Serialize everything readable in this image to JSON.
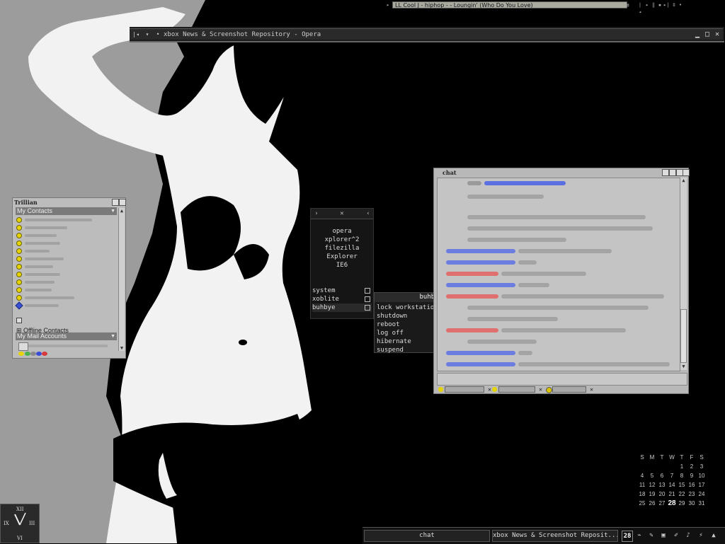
{
  "media_player": {
    "track_title": "LL Cool J - hiphop - - Loungin' (Who Do You Love)",
    "icons": [
      "prev-icon",
      "play-icon",
      "pause-icon",
      "stop-icon",
      "next-icon",
      "menu-icon"
    ]
  },
  "browser_window": {
    "title": "xbox News & Screenshot Repository - Opera",
    "left_buttons": [
      "back-icon",
      "menu-icon",
      "dot-icon"
    ],
    "right_buttons": [
      "minimize-icon",
      "maximize-icon",
      "close-icon"
    ]
  },
  "trillian": {
    "title": "Trillian",
    "groups": {
      "my_contacts": "My Contacts",
      "offline_contacts": "Offline Contacts",
      "my_mail_accounts": "My Mail Accounts"
    }
  },
  "launcher": {
    "apps": [
      "opera",
      "xplorer^2",
      "filezilla",
      "Explorer",
      "IE6"
    ],
    "menu": [
      "system",
      "xoblite",
      "buhbye"
    ]
  },
  "submenu": {
    "header": "buhbye",
    "items": [
      "lock workstation",
      "shutdown",
      "reboot",
      "log off",
      "hibernate",
      "suspend"
    ]
  },
  "chat": {
    "title": "chat"
  },
  "calendar": {
    "weekdays": [
      "S",
      "M",
      "T",
      "W",
      "T",
      "F",
      "S"
    ],
    "weeks": [
      [
        "",
        "",
        "",
        "",
        "1",
        "2",
        "3"
      ],
      [
        "4",
        "5",
        "6",
        "7",
        "8",
        "9",
        "10"
      ],
      [
        "11",
        "12",
        "13",
        "14",
        "15",
        "16",
        "17"
      ],
      [
        "18",
        "19",
        "20",
        "21",
        "22",
        "23",
        "24"
      ],
      [
        "25",
        "26",
        "27",
        "28",
        "29",
        "30",
        "31"
      ]
    ],
    "today": "28"
  },
  "clock": {
    "numerals": [
      "XII",
      "III",
      "VI",
      "IX"
    ]
  },
  "taskbar": {
    "tasks": [
      "chat",
      "xbox News & Screenshot Reposit..."
    ],
    "tray_date": "28"
  },
  "colors": {
    "wallpaper_gray": "#9c9c9c",
    "contact_online": "#e6d400",
    "chat_link": "#4a5fd6",
    "chat_name_blue": "#6c7de0",
    "chat_name_red": "#e07070"
  }
}
